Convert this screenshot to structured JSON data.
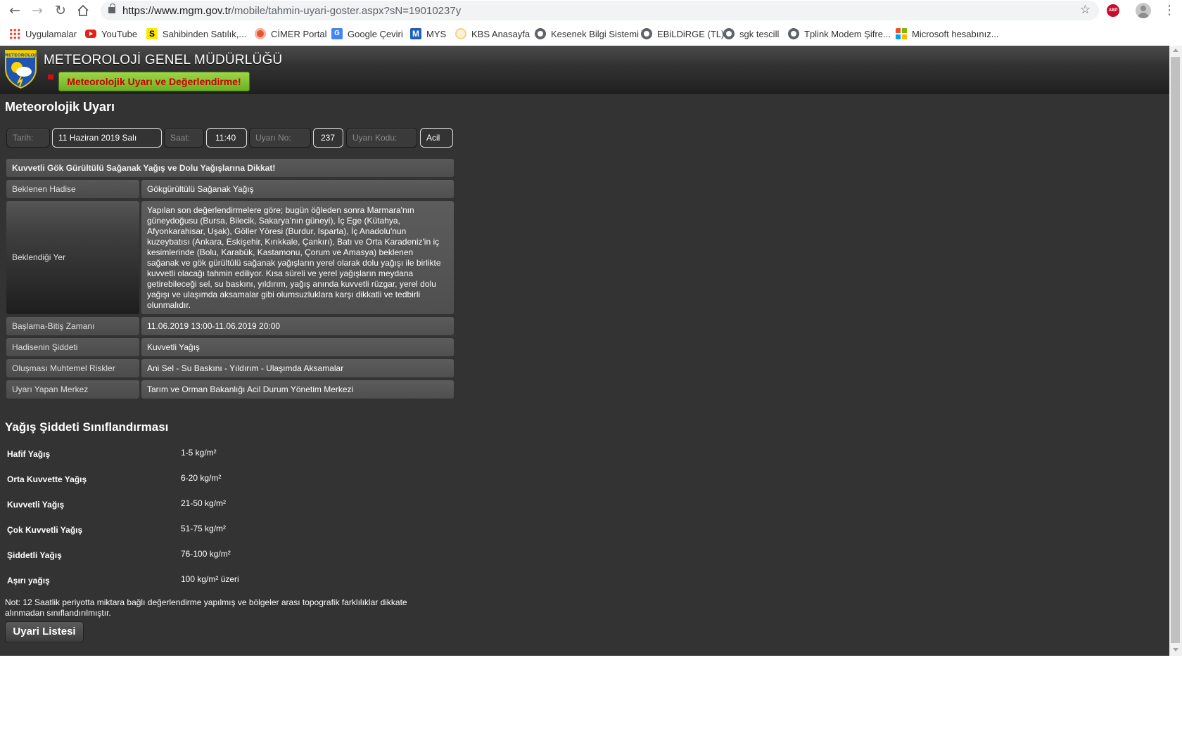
{
  "browser": {
    "url_host": "https://www.mgm.gov.tr",
    "url_path": "/mobile/tahmin-uyari-goster.aspx?sN=19010237y",
    "bookmarks": [
      {
        "label": "Uygulamalar",
        "icon": "apps-grid-icon"
      },
      {
        "label": "YouTube",
        "icon": "youtube-icon"
      },
      {
        "label": "Sahibinden Satılık,...",
        "icon": "sahibinden-icon"
      },
      {
        "label": "CİMER Portal",
        "icon": "cimer-icon"
      },
      {
        "label": "Google Çeviri",
        "icon": "google-translate-icon"
      },
      {
        "label": "MYS",
        "icon": "mys-icon"
      },
      {
        "label": "KBS Anasayfa",
        "icon": "kbs-icon"
      },
      {
        "label": "Kesenek Bilgi Sistemi",
        "icon": "globe-icon"
      },
      {
        "label": "EBiLDiRGE (TL)",
        "icon": "globe-icon"
      },
      {
        "label": "sgk tescill",
        "icon": "globe-icon"
      },
      {
        "label": "Tplink Modem Şifre...",
        "icon": "globe-icon"
      },
      {
        "label": "Microsoft hesabınız...",
        "icon": "microsoft-icon"
      }
    ],
    "abp_label": "ABP"
  },
  "header": {
    "logo_text": "METEOROLOJİ",
    "site_title": "METEOROLOJİ GENEL MÜDÜRLÜĞÜ",
    "section_button": "Meteorolojik Uyarı ve Değerlendirme!"
  },
  "page": {
    "title": "Meteorolojik Uyarı",
    "info": {
      "date_label": "Tarih:",
      "date_value": "11 Haziran 2019 Salı",
      "time_label": "Saat:",
      "time_value": "11:40",
      "no_label": "Uyarı No:",
      "no_value": "237",
      "code_label": "Uyarı Kodu:",
      "code_value": "Acil"
    },
    "warning_title": "Kuvvetli Gök Gürültülü Sağanak Yağış ve Dolu Yağışlarına Dikkat!",
    "rows": {
      "event_label": "Beklenen Hadise",
      "event_value": "Gökgürültülü Sağanak Yağış",
      "place_label": "Beklendiği Yer",
      "place_value": "Yapılan son değerlendirmelere göre; bugün öğleden sonra Marmara'nın güneydoğusu (Bursa, Bilecik, Sakarya'nın güneyi), İç Ege (Kütahya, Afyonkarahisar, Uşak), Göller Yöresi (Burdur, Isparta), İç Anadolu'nun kuzeybatısı (Ankara, Eskişehir, Kırıkkale, Çankırı), Batı ve Orta Karadeniz'in iç kesimlerinde (Bolu, Karabük, Kastamonu, Çorum ve Amasya) beklenen sağanak ve gök gürültülü sağanak yağışların yerel olarak dolu yağışı ile birlikte kuvvetli olacağı tahmin ediliyor. Kısa süreli ve yerel yağışların meydana getirebileceği sel, su baskını, yıldırım, yağış anında kuvvetli rüzgar, yerel dolu yağışı ve ulaşımda aksamalar gibi olumsuzluklara karşı dikkatli ve tedbirli olunmalıdır.",
      "time_label": "Başlama-Bitiş Zamanı",
      "time_value": "11.06.2019 13:00-11.06.2019 20:00",
      "severity_label": "Hadisenin Şiddeti",
      "severity_value": "Kuvvetli Yağış",
      "risks_label": "Oluşması Muhtemel Riskler",
      "risks_value": "Ani Sel - Su Baskını - Yıldırım - Ulaşımda Aksamalar",
      "center_label": "Uyarı Yapan Merkez",
      "center_value": "Tarım ve Orman Bakanlığı Acil Durum Yönetim Merkezi"
    },
    "classification_title": "Yağış Şiddeti Sınıflandırması",
    "classification": [
      {
        "name": "Hafif Yağış",
        "value": "1-5 kg/m²"
      },
      {
        "name": "Orta Kuvvette Yağış",
        "value": "6-20 kg/m²"
      },
      {
        "name": "Kuvvetli Yağış",
        "value": "21-50 kg/m²"
      },
      {
        "name": "Çok Kuvvetli Yağış",
        "value": "51-75 kg/m²"
      },
      {
        "name": "Şiddetli Yağış",
        "value": "76-100 kg/m²"
      },
      {
        "name": "Aşırı yağış",
        "value": "100 kg/m² üzeri"
      }
    ],
    "note": "Not: 12 Saatlik periyotta miktara bağlı değerlendirme yapılmış ve bölgeler arası topografik farklılıklar dikkate alınmadan sınıflandırılmıştır.",
    "list_button": "Uyari Listesi"
  }
}
